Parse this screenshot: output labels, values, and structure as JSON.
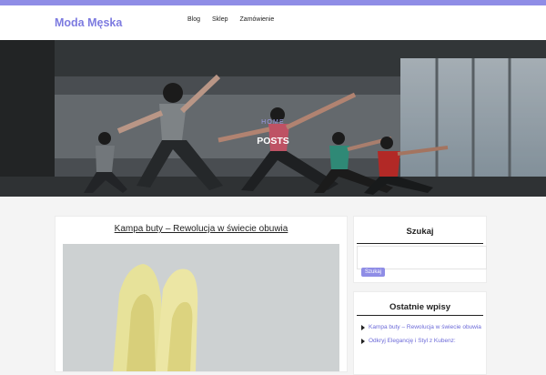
{
  "site": {
    "title": "Moda Męska"
  },
  "nav": {
    "items": [
      "Blog",
      "Sklep",
      "Zamówienie"
    ]
  },
  "hero": {
    "breadcrumb": "HOME",
    "title": "POSTS"
  },
  "post": {
    "title": "Kampa buty – Rewolucja w świecie obuwia"
  },
  "sidebar": {
    "search": {
      "title": "Szukaj",
      "button": "Szukaj",
      "placeholder": ""
    },
    "recent": {
      "title": "Ostatnie wpisy",
      "items": [
        "Kampa buty – Rewolucja w świecie obuwia",
        "Odkryj Elegancję i Styl z Kubenz:"
      ]
    }
  },
  "colors": {
    "accent": "#8f8de6",
    "link": "#6c6ad8",
    "logo": "#7d7be0"
  }
}
